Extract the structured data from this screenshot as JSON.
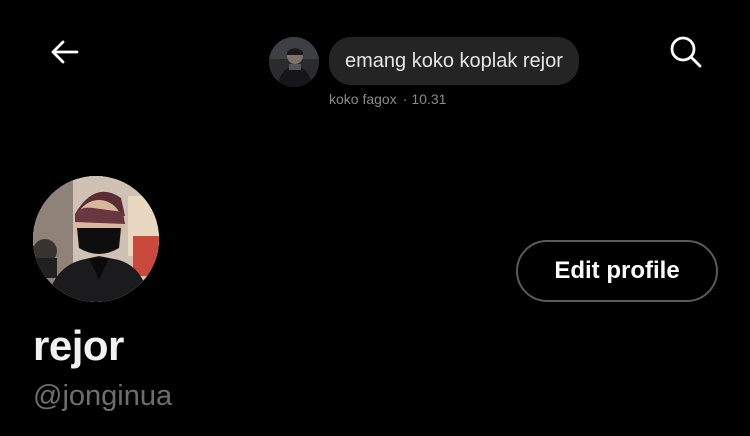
{
  "header": {
    "back_icon": "arrow-left-icon",
    "search_icon": "search-icon"
  },
  "message": {
    "avatar_icon": "sender-avatar",
    "text": "emang koko koplak rejor",
    "sender": "koko fagox",
    "separator": "·",
    "time": "10.31"
  },
  "profile": {
    "avatar_icon": "profile-avatar",
    "edit_label": "Edit profile",
    "display_name": "rejor",
    "handle": "@jonginua"
  },
  "colors": {
    "background": "#000000",
    "bubble": "#242424",
    "muted_text": "#6e6e6e",
    "button_border": "#5a5a5a"
  }
}
